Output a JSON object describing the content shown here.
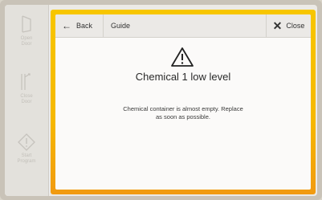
{
  "sidebar": {
    "items": [
      {
        "label_1": "Open",
        "label_2": "Door",
        "icon": "open-door-icon"
      },
      {
        "label_1": "Close",
        "label_2": "Door",
        "icon": "close-door-icon"
      },
      {
        "label_1": "Start",
        "label_2": "Program",
        "icon": "start-program-icon"
      }
    ]
  },
  "header": {
    "back_label": "Back",
    "guide_label": "Guide",
    "close_label": "Close"
  },
  "alert": {
    "icon": "warning-icon",
    "title": "Chemical 1 low level",
    "message_line1": "Chemical container is almost empty. Replace",
    "message_line2": "as soon as possible."
  },
  "colors": {
    "accent": "#f6b800",
    "accent_bottom": "#f19a10"
  }
}
